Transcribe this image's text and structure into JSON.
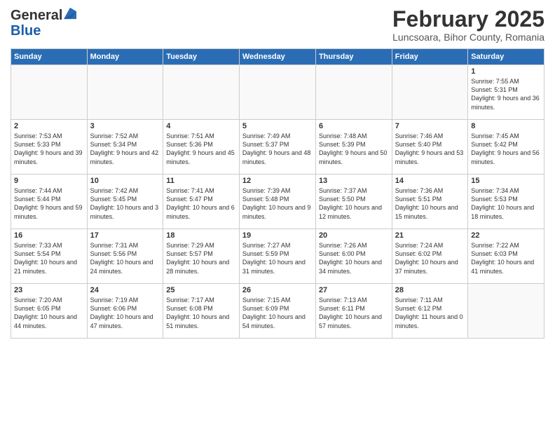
{
  "header": {
    "logo_general": "General",
    "logo_blue": "Blue",
    "month_title": "February 2025",
    "location": "Luncsoara, Bihor County, Romania"
  },
  "days_of_week": [
    "Sunday",
    "Monday",
    "Tuesday",
    "Wednesday",
    "Thursday",
    "Friday",
    "Saturday"
  ],
  "weeks": [
    [
      {
        "day": "",
        "info": ""
      },
      {
        "day": "",
        "info": ""
      },
      {
        "day": "",
        "info": ""
      },
      {
        "day": "",
        "info": ""
      },
      {
        "day": "",
        "info": ""
      },
      {
        "day": "",
        "info": ""
      },
      {
        "day": "1",
        "info": "Sunrise: 7:55 AM\nSunset: 5:31 PM\nDaylight: 9 hours and 36 minutes."
      }
    ],
    [
      {
        "day": "2",
        "info": "Sunrise: 7:53 AM\nSunset: 5:33 PM\nDaylight: 9 hours and 39 minutes."
      },
      {
        "day": "3",
        "info": "Sunrise: 7:52 AM\nSunset: 5:34 PM\nDaylight: 9 hours and 42 minutes."
      },
      {
        "day": "4",
        "info": "Sunrise: 7:51 AM\nSunset: 5:36 PM\nDaylight: 9 hours and 45 minutes."
      },
      {
        "day": "5",
        "info": "Sunrise: 7:49 AM\nSunset: 5:37 PM\nDaylight: 9 hours and 48 minutes."
      },
      {
        "day": "6",
        "info": "Sunrise: 7:48 AM\nSunset: 5:39 PM\nDaylight: 9 hours and 50 minutes."
      },
      {
        "day": "7",
        "info": "Sunrise: 7:46 AM\nSunset: 5:40 PM\nDaylight: 9 hours and 53 minutes."
      },
      {
        "day": "8",
        "info": "Sunrise: 7:45 AM\nSunset: 5:42 PM\nDaylight: 9 hours and 56 minutes."
      }
    ],
    [
      {
        "day": "9",
        "info": "Sunrise: 7:44 AM\nSunset: 5:44 PM\nDaylight: 9 hours and 59 minutes."
      },
      {
        "day": "10",
        "info": "Sunrise: 7:42 AM\nSunset: 5:45 PM\nDaylight: 10 hours and 3 minutes."
      },
      {
        "day": "11",
        "info": "Sunrise: 7:41 AM\nSunset: 5:47 PM\nDaylight: 10 hours and 6 minutes."
      },
      {
        "day": "12",
        "info": "Sunrise: 7:39 AM\nSunset: 5:48 PM\nDaylight: 10 hours and 9 minutes."
      },
      {
        "day": "13",
        "info": "Sunrise: 7:37 AM\nSunset: 5:50 PM\nDaylight: 10 hours and 12 minutes."
      },
      {
        "day": "14",
        "info": "Sunrise: 7:36 AM\nSunset: 5:51 PM\nDaylight: 10 hours and 15 minutes."
      },
      {
        "day": "15",
        "info": "Sunrise: 7:34 AM\nSunset: 5:53 PM\nDaylight: 10 hours and 18 minutes."
      }
    ],
    [
      {
        "day": "16",
        "info": "Sunrise: 7:33 AM\nSunset: 5:54 PM\nDaylight: 10 hours and 21 minutes."
      },
      {
        "day": "17",
        "info": "Sunrise: 7:31 AM\nSunset: 5:56 PM\nDaylight: 10 hours and 24 minutes."
      },
      {
        "day": "18",
        "info": "Sunrise: 7:29 AM\nSunset: 5:57 PM\nDaylight: 10 hours and 28 minutes."
      },
      {
        "day": "19",
        "info": "Sunrise: 7:27 AM\nSunset: 5:59 PM\nDaylight: 10 hours and 31 minutes."
      },
      {
        "day": "20",
        "info": "Sunrise: 7:26 AM\nSunset: 6:00 PM\nDaylight: 10 hours and 34 minutes."
      },
      {
        "day": "21",
        "info": "Sunrise: 7:24 AM\nSunset: 6:02 PM\nDaylight: 10 hours and 37 minutes."
      },
      {
        "day": "22",
        "info": "Sunrise: 7:22 AM\nSunset: 6:03 PM\nDaylight: 10 hours and 41 minutes."
      }
    ],
    [
      {
        "day": "23",
        "info": "Sunrise: 7:20 AM\nSunset: 6:05 PM\nDaylight: 10 hours and 44 minutes."
      },
      {
        "day": "24",
        "info": "Sunrise: 7:19 AM\nSunset: 6:06 PM\nDaylight: 10 hours and 47 minutes."
      },
      {
        "day": "25",
        "info": "Sunrise: 7:17 AM\nSunset: 6:08 PM\nDaylight: 10 hours and 51 minutes."
      },
      {
        "day": "26",
        "info": "Sunrise: 7:15 AM\nSunset: 6:09 PM\nDaylight: 10 hours and 54 minutes."
      },
      {
        "day": "27",
        "info": "Sunrise: 7:13 AM\nSunset: 6:11 PM\nDaylight: 10 hours and 57 minutes."
      },
      {
        "day": "28",
        "info": "Sunrise: 7:11 AM\nSunset: 6:12 PM\nDaylight: 11 hours and 0 minutes."
      },
      {
        "day": "",
        "info": ""
      }
    ]
  ]
}
